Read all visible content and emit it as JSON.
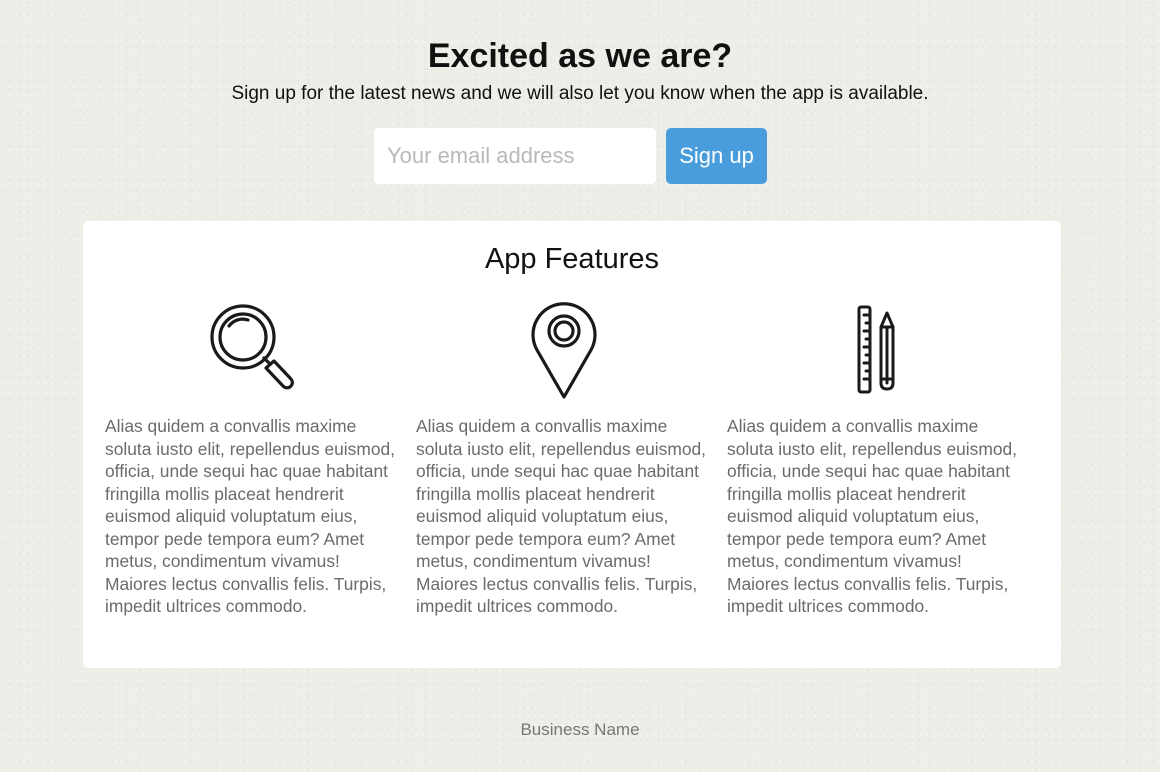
{
  "signup": {
    "heading": "Excited as we are?",
    "subheading": "Sign up for the latest news and we will also let you know when the app is available.",
    "email_placeholder": "Your email address",
    "button_label": "Sign up"
  },
  "features": {
    "title": "App Features",
    "items": [
      {
        "icon": "magnifier-icon",
        "text": "Alias quidem a convallis maxime soluta iusto elit, repellendus euismod, officia, unde sequi hac quae habitant fringilla mollis placeat hendrerit euismod aliquid voluptatum eius, tempor pede tempora eum? Amet metus, condimentum vivamus! Maiores lectus convallis felis. Turpis, impedit ultrices commodo."
      },
      {
        "icon": "map-pin-icon",
        "text": "Alias quidem a convallis maxime soluta iusto elit, repellendus euismod, officia, unde sequi hac quae habitant fringilla mollis placeat hendrerit euismod aliquid voluptatum eius, tempor pede tempora eum? Amet metus, condimentum vivamus! Maiores lectus convallis felis. Turpis, impedit ultrices commodo."
      },
      {
        "icon": "ruler-pencil-icon",
        "text": "Alias quidem a convallis maxime soluta iusto elit, repellendus euismod, officia, unde sequi hac quae habitant fringilla mollis placeat hendrerit euismod aliquid voluptatum eius, tempor pede tempora eum? Amet metus, condimentum vivamus! Maiores lectus convallis felis. Turpis, impedit ultrices commodo."
      }
    ]
  },
  "footer": {
    "business_name": "Business Name"
  },
  "colors": {
    "accent": "#4a9ddc",
    "background": "#efede8",
    "card": "#ffffff",
    "body_text": "#6b6b6b"
  }
}
